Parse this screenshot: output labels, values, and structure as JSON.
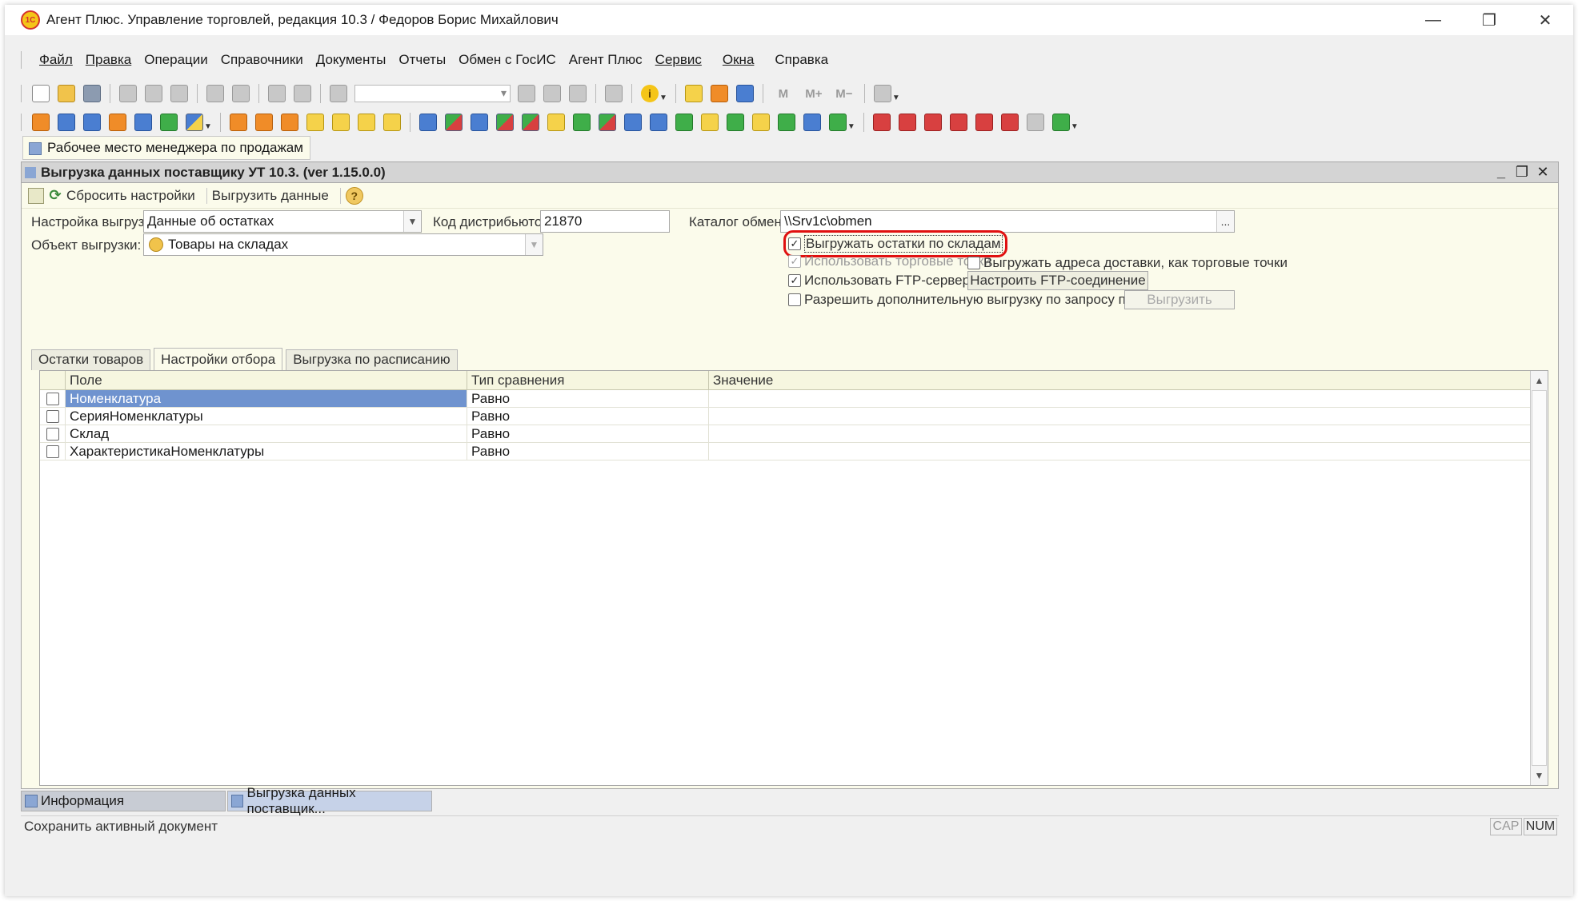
{
  "window": {
    "title": "Агент Плюс. Управление торговлей, редакция 10.3 / Федоров Борис Михайлович",
    "logo_text": "1С",
    "minimize": "—",
    "restore": "❐",
    "close": "✕"
  },
  "menu": [
    {
      "label": "Файл",
      "underline": true
    },
    {
      "label": "Правка",
      "underline": true
    },
    {
      "label": "Операции",
      "underline": false
    },
    {
      "label": "Справочники",
      "underline": false
    },
    {
      "label": "Документы",
      "underline": false
    },
    {
      "label": "Отчеты",
      "underline": false
    },
    {
      "label": "Обмен с ГосИС",
      "underline": false
    },
    {
      "label": "Агент Плюс",
      "underline": false
    },
    {
      "label": "Сервис",
      "underline": true
    },
    {
      "label": "Окна",
      "underline": true
    },
    {
      "label": "Справка",
      "underline": false
    }
  ],
  "toolbar": {
    "letter_m": "M",
    "letter_mplus": "M+",
    "letter_mminus": "M−",
    "info_glyph": "i"
  },
  "panel": {
    "button_label": "Рабочее место менеджера по продажам"
  },
  "form": {
    "title": "Выгрузка данных поставщику УТ 10.3. (ver 1.15.0.0)",
    "controls": {
      "minimize": "_",
      "restore": "❐",
      "close": "✕"
    },
    "commands": {
      "reset": "Сбросить настройки",
      "export": "Выгрузить данные",
      "help": "?"
    },
    "fields": {
      "setting_label": "Настройка выгрузки:",
      "setting_value": "Данные об остатках",
      "distributor_label": "Код дистрибьютор..",
      "distributor_value": "21870",
      "catalog_label": "Каталог обмена:",
      "catalog_value": "\\\\Srv1c\\obmen",
      "object_label": "Объект выгрузки:",
      "object_value": "Товары на складах"
    },
    "checkboxes": {
      "by_warehouses": {
        "label": "Выгружать остатки по складам",
        "checked": true
      },
      "trade_points": {
        "label": "Использовать торговые точки",
        "checked": true,
        "disabled": true
      },
      "delivery_addresses": {
        "label": "Выгружать адреса доставки, как торговые точки",
        "checked": false
      },
      "ftp": {
        "label": "Использовать FTP-сервер",
        "checked": true
      },
      "additional": {
        "label": "Разрешить дополнительную выгрузку по запросу поставщика",
        "checked": false
      }
    },
    "buttons": {
      "ftp_setup": "Настроить FTP-соединение",
      "export_disabled": "Выгрузить"
    },
    "tabs": [
      {
        "label": "Остатки товаров",
        "active": false
      },
      {
        "label": "Настройки отбора",
        "active": true
      },
      {
        "label": "Выгрузка по расписанию",
        "active": false
      }
    ],
    "table": {
      "columns": [
        "Поле",
        "Тип сравнения",
        "Значение"
      ],
      "rows": [
        {
          "field": "Номенклатура",
          "comparison": "Равно",
          "value": "",
          "selected": true
        },
        {
          "field": "СерияНоменклатуры",
          "comparison": "Равно",
          "value": "",
          "selected": false
        },
        {
          "field": "Склад",
          "comparison": "Равно",
          "value": "",
          "selected": false
        },
        {
          "field": "ХарактеристикаНоменклатуры",
          "comparison": "Равно",
          "value": "",
          "selected": false
        }
      ]
    }
  },
  "window_tabs": [
    {
      "label": "Информация",
      "active": false
    },
    {
      "label": "Выгрузка данных поставщик...",
      "active": true
    }
  ],
  "status": {
    "text": "Сохранить активный документ",
    "cap": "CAP",
    "num": "NUM"
  },
  "colors": {
    "selection": "#6f93cf",
    "form_bg": "#fbfbeb",
    "highlight": "#e01010"
  }
}
